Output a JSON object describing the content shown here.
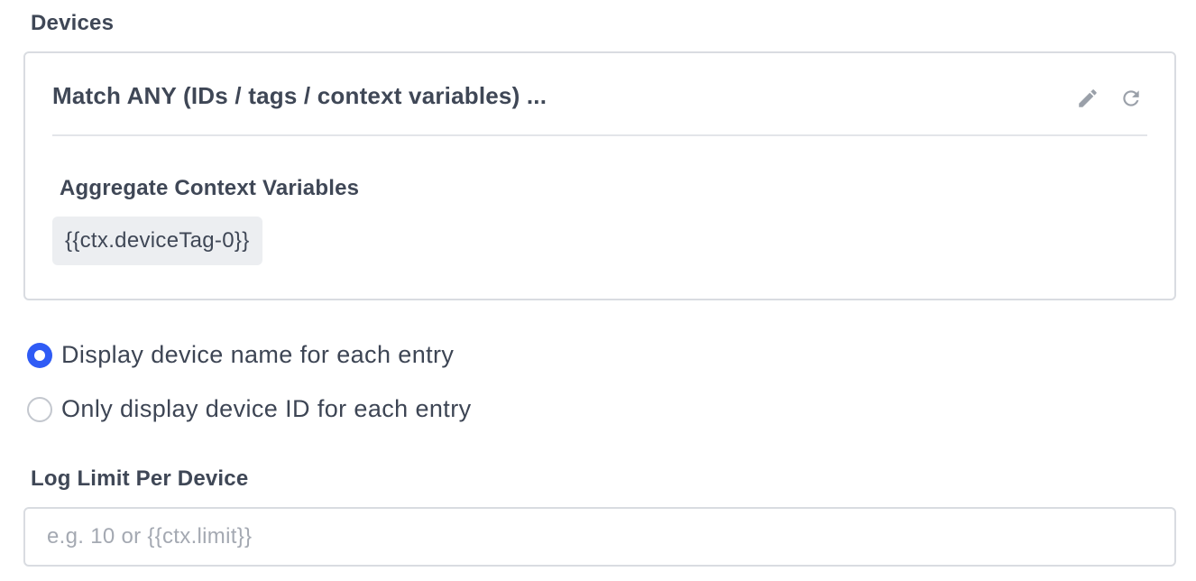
{
  "devices": {
    "label": "Devices",
    "card": {
      "title": "Match ANY (IDs / tags / context variables) ...",
      "edit_icon": "pencil-icon",
      "refresh_icon": "refresh-icon",
      "aggregate_label": "Aggregate Context Variables",
      "chips": [
        "{{ctx.deviceTag-0}}"
      ]
    }
  },
  "display_options": [
    {
      "label": "Display device name for each entry",
      "selected": true
    },
    {
      "label": "Only display device ID for each entry",
      "selected": false
    }
  ],
  "log_limit": {
    "label": "Log Limit Per Device",
    "value": "",
    "placeholder": "e.g. 10 or {{ctx.limit}}"
  },
  "colors": {
    "accent": "#2f5bf5",
    "text": "#3d4554",
    "border": "#d9dce1",
    "chip_bg": "#eceef1",
    "icon": "#9aa0a9"
  }
}
